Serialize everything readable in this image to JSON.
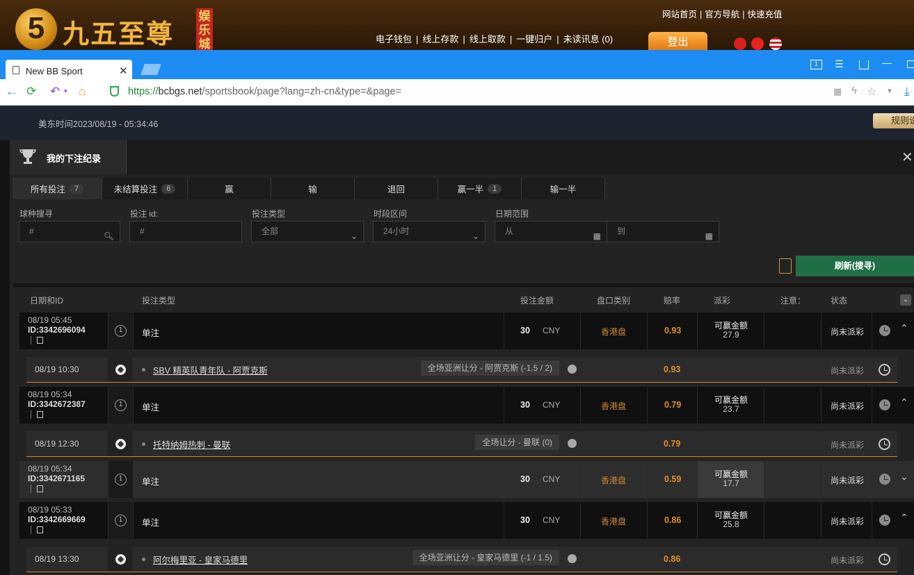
{
  "site": {
    "logo_digit": "5",
    "logo_text": "九五至尊",
    "logo_tag": "娱乐城",
    "top_links": [
      "网站首页",
      "官方导航",
      "快速充值"
    ],
    "user_menu": [
      "电子钱包",
      "线上存款",
      "线上取款",
      "一键归户",
      "未读讯息 (0)"
    ],
    "logout": "登出"
  },
  "browser": {
    "tab_title": "New BB Sport",
    "url_scheme": "https://",
    "url_host": "bcbgs.net",
    "url_path": "/sportsbook/page?lang=zh-cn&type=&page="
  },
  "page": {
    "clock": "美东时间2023/08/19 - 05:34:46",
    "rules": "规则说"
  },
  "modal": {
    "title": "我的下注纪录",
    "tabs": [
      {
        "label": "所有投注",
        "count": "7"
      },
      {
        "label": "未结算投注",
        "count": "6"
      },
      {
        "label": "赢"
      },
      {
        "label": "输"
      },
      {
        "label": "退回"
      },
      {
        "label": "赢一半",
        "count": "1"
      },
      {
        "label": "输一半"
      }
    ],
    "filters": {
      "sport_label": "球种搜寻",
      "sport_ph": "#",
      "id_label": "投注 id:",
      "id_ph": "#",
      "type_label": "投注类型",
      "type_value": "全部",
      "period_label": "时段区间",
      "period_value": "24小时",
      "date_label": "日期范围",
      "date_from": "从",
      "date_to": "到"
    },
    "refresh": "刷新(搜寻)",
    "columns": [
      "日期和ID",
      "投注类型",
      "投注金额",
      "盘口类别",
      "赔率",
      "派彩",
      "注意：",
      "状态"
    ]
  },
  "bets": [
    {
      "date": "08/19 05:45",
      "id": "ID:3342696094",
      "type": "单注",
      "amount": "30",
      "currency": "CNY",
      "market": "香港盘",
      "odds": "0.93",
      "payout_label": "可赢金额",
      "payout": "27.9",
      "status": "尚未派彩",
      "sub": {
        "time": "08/19 10:30",
        "match": "SBV 精英队青年队 - 阿贾克斯",
        "bet": "全场亚洲让分 - 阿贾克斯 (-1.5 / 2)",
        "odds": "0.93",
        "status": "尚未派彩"
      }
    },
    {
      "date": "08/19 05:34",
      "id": "ID:3342672387",
      "type": "单注",
      "amount": "30",
      "currency": "CNY",
      "market": "香港盘",
      "odds": "0.79",
      "payout_label": "可赢金额",
      "payout": "23.7",
      "status": "尚未派彩",
      "sub": {
        "time": "08/19 12:30",
        "match": "托特纳姆热刺 - 曼联",
        "bet": "全场让分 - 曼联 (0)",
        "odds": "0.79",
        "status": "尚未派彩"
      }
    },
    {
      "date": "08/19 05:34",
      "id": "ID:3342671165",
      "type": "单注",
      "amount": "30",
      "currency": "CNY",
      "market": "香港盘",
      "odds": "0.59",
      "payout_label": "可赢金额",
      "payout": "17.7",
      "status": "尚未派彩"
    },
    {
      "date": "08/19 05:33",
      "id": "ID:3342669669",
      "type": "单注",
      "amount": "30",
      "currency": "CNY",
      "market": "香港盘",
      "odds": "0.86",
      "payout_label": "可赢金额",
      "payout": "25.8",
      "status": "尚未派彩",
      "sub": {
        "time": "08/19 13:30",
        "match": "阿尔梅里亚 - 皇家马德里",
        "bet": "全场亚洲让分 - 皇家马德里 (-1 / 1.5)",
        "odds": "0.86",
        "status": "尚未派彩"
      }
    }
  ]
}
